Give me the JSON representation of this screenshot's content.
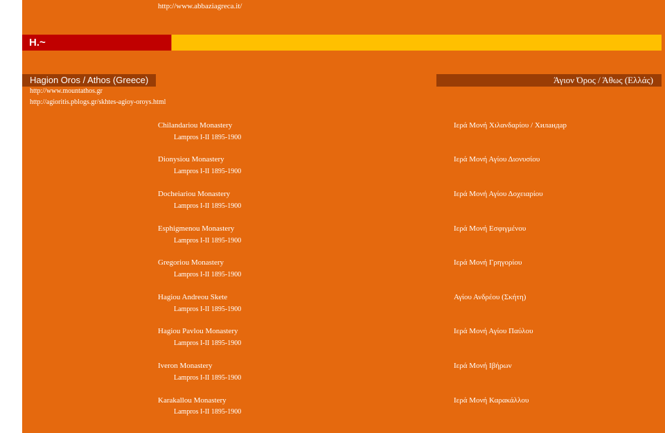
{
  "header": {
    "top_link": "http://www.abbaziagreca.it/",
    "title": "H.~"
  },
  "region": {
    "left_label": "Hagion Oros / Athos (Greece)",
    "right_label": "Άγιον Όρος / Άθως (Ελλάς)",
    "links": [
      "http://www.mountathos.gr",
      "http://agioritis.pblogs.gr/skhtes-agioy-oroys.html"
    ]
  },
  "monasteries": [
    {
      "name": "Chilandariou Monastery",
      "ref": "Lampros I-II 1895-1900",
      "greek": "Ιερά Μονή Χιλανδαρίου / Хиландар"
    },
    {
      "name": "Dionysiou Monastery",
      "ref": "Lampros I-II 1895-1900",
      "greek": "Ιερά Μονή Αγίου Διονυσίου"
    },
    {
      "name": "Docheiariou Monastery",
      "ref": "Lampros I-II 1895-1900",
      "greek": "Ιερά Μονή Αγίου Δοχειαρίου"
    },
    {
      "name": "Esphigmenou Monastery",
      "ref": "Lampros I-II 1895-1900",
      "greek": "Ιερά Μονή Εσφιγμένου"
    },
    {
      "name": "Gregoriou Monastery",
      "ref": "Lampros I-II 1895-1900",
      "greek": "Ιερά Μονή Γρηγορίου"
    },
    {
      "name": "Hagiou Andreou Skete",
      "ref": "Lampros I-II 1895-1900",
      "greek": "Αγίου Ανδρέου (Σκήτη)"
    },
    {
      "name": "Hagiou Pavlou Monastery",
      "ref": "Lampros I-II 1895-1900",
      "greek": "Ιερά Μονή Αγίου Παύλου"
    },
    {
      "name": "Iveron Monastery",
      "ref": "Lampros I-II 1895-1900",
      "greek": "Ιερά Μονή Ιβήρων"
    },
    {
      "name": "Karakallou Monastery",
      "ref": "Lampros I-II 1895-1900",
      "greek": "Ιερά Μονή Καρακάλλου"
    }
  ],
  "colors": {
    "background": "#e5690e",
    "title_box": "#c00000",
    "title_bar": "#ffc000",
    "region_bar": "#9a3d05"
  }
}
